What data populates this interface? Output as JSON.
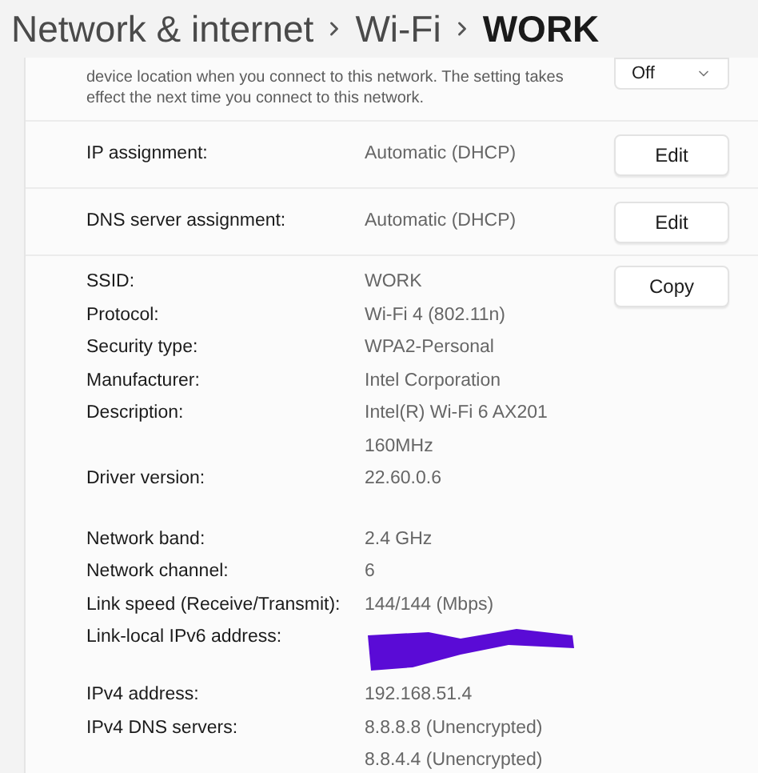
{
  "header": {
    "breadcrumbs": [
      {
        "text": "Network & internet",
        "current": false
      },
      {
        "text": "Wi-Fi",
        "current": false
      },
      {
        "text": "WORK",
        "current": true
      }
    ]
  },
  "location_setting": {
    "description": "device location when you connect to this network. The setting takes effect the next time you connect to this network.",
    "dropdown": {
      "value": "Off"
    }
  },
  "assignments": [
    {
      "label": "IP assignment:",
      "value": "Automatic (DHCP)",
      "button": "Edit"
    },
    {
      "label": "DNS server assignment:",
      "value": "Automatic (DHCP)",
      "button": "Edit"
    }
  ],
  "properties": {
    "button": "Copy",
    "groups": [
      [
        {
          "kind": "text",
          "label": "SSID:",
          "values": [
            "WORK"
          ]
        },
        {
          "kind": "text",
          "label": "Protocol:",
          "values": [
            "Wi-Fi 4 (802.11n)"
          ]
        },
        {
          "kind": "text",
          "label": "Security type:",
          "values": [
            "WPA2-Personal"
          ]
        },
        {
          "kind": "text",
          "label": "Manufacturer:",
          "values": [
            "Intel Corporation"
          ]
        },
        {
          "kind": "text",
          "label": "Description:",
          "values": [
            "Intel(R) Wi-Fi 6 AX201",
            "160MHz"
          ]
        },
        {
          "kind": "text",
          "label": "Driver version:",
          "values": [
            "22.60.0.6"
          ]
        }
      ],
      [
        {
          "kind": "text",
          "label": "Network band:",
          "values": [
            "2.4 GHz"
          ]
        },
        {
          "kind": "text",
          "label": "Network channel:",
          "values": [
            "6"
          ]
        },
        {
          "kind": "text",
          "label": "Link speed (Receive/Transmit):",
          "values": [
            "144/144 (Mbps)"
          ]
        },
        {
          "kind": "redacted",
          "label": "Link-local IPv6 address:"
        },
        {
          "kind": "text",
          "label": "IPv4 address:",
          "values": [
            "192.168.51.4"
          ]
        },
        {
          "kind": "text",
          "label": "IPv4 DNS servers:",
          "values": [
            "8.8.8.8 (Unencrypted)",
            "8.8.4.4 (Unencrypted)"
          ]
        }
      ]
    ]
  }
}
